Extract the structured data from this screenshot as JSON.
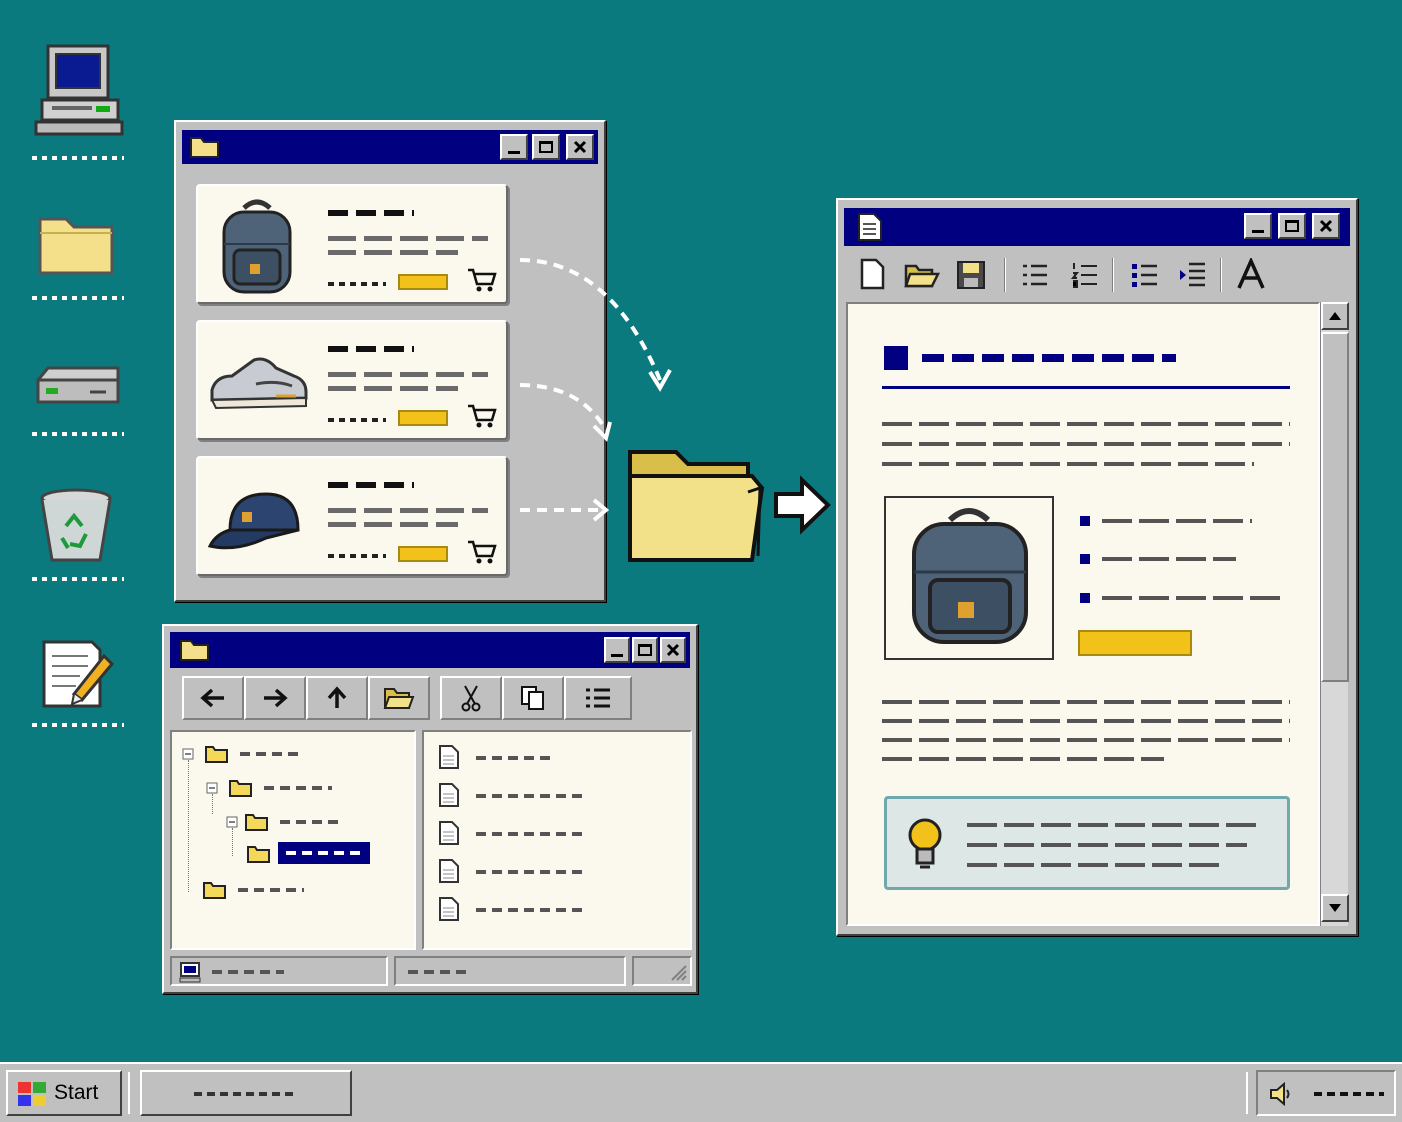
{
  "desktop": {
    "icons": [
      {
        "name": "my-computer"
      },
      {
        "name": "folder"
      },
      {
        "name": "drive"
      },
      {
        "name": "recycle-bin"
      },
      {
        "name": "notepad"
      }
    ]
  },
  "shop_window": {
    "products": [
      {
        "name": "backpack"
      },
      {
        "name": "sneaker"
      },
      {
        "name": "cap"
      }
    ]
  },
  "doc_window": {
    "toolbar": [
      "new",
      "open",
      "save",
      "list-a",
      "list-b",
      "bullets",
      "indent",
      "font"
    ]
  },
  "explorer": {
    "toolbar": [
      "back",
      "forward",
      "up",
      "open",
      "cut",
      "copy",
      "views"
    ]
  },
  "taskbar": {
    "start_label": "Start"
  },
  "colors": {
    "desktop": "#0b7a7f",
    "titlebar": "#000080",
    "accent": "#f2c21b"
  }
}
